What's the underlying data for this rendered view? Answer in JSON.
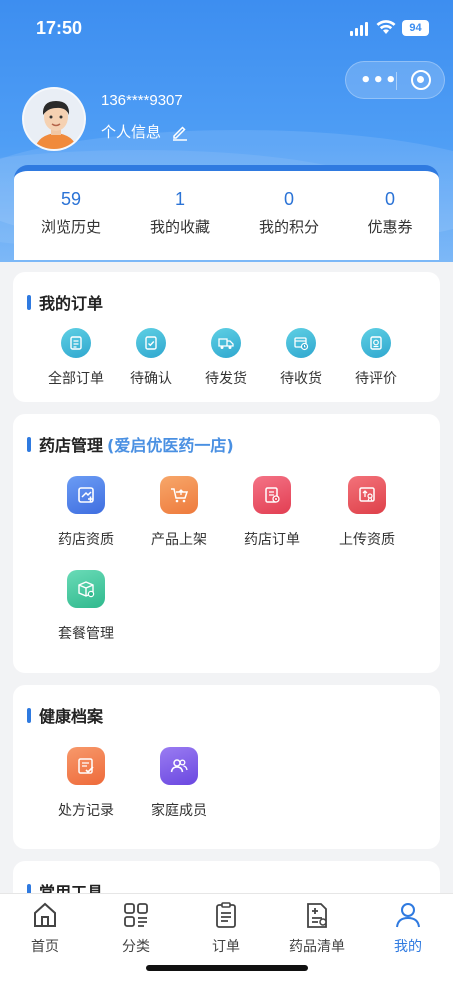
{
  "status": {
    "time": "17:50",
    "battery": "94"
  },
  "user": {
    "phone": "136****9307",
    "profile_label": "个人信息"
  },
  "stats": [
    {
      "value": "59",
      "label": "浏览历史"
    },
    {
      "value": "1",
      "label": "我的收藏"
    },
    {
      "value": "0",
      "label": "我的积分"
    },
    {
      "value": "0",
      "label": "优惠券"
    }
  ],
  "orders": {
    "title": "我的订单",
    "items": [
      {
        "label": "全部订单",
        "icon": "clipboard-icon"
      },
      {
        "label": "待确认",
        "icon": "check-document-icon"
      },
      {
        "label": "待发货",
        "icon": "truck-icon"
      },
      {
        "label": "待收货",
        "icon": "box-clock-icon"
      },
      {
        "label": "待评价",
        "icon": "review-icon"
      }
    ]
  },
  "pharmacy": {
    "title": "药店管理",
    "store_name": "(爱启优医药一店)",
    "items": [
      {
        "label": "药店资质",
        "icon": "certificate-icon",
        "color": "#4a7de8"
      },
      {
        "label": "产品上架",
        "icon": "cart-upload-icon",
        "color": "#f08a4b"
      },
      {
        "label": "药店订单",
        "icon": "order-settings-icon",
        "color": "#ec4d5f"
      },
      {
        "label": "上传资质",
        "icon": "upload-certificate-icon",
        "color": "#e8505b"
      },
      {
        "label": "套餐管理",
        "icon": "package-settings-icon",
        "color": "#3ec9a0"
      }
    ]
  },
  "health": {
    "title": "健康档案",
    "items": [
      {
        "label": "处方记录",
        "icon": "prescription-icon",
        "color": "#f0794b"
      },
      {
        "label": "家庭成员",
        "icon": "family-icon",
        "color": "#7c5ae6"
      }
    ]
  },
  "tools": {
    "title": "常用工具"
  },
  "tabbar": [
    {
      "label": "首页",
      "icon": "home-icon"
    },
    {
      "label": "分类",
      "icon": "category-icon"
    },
    {
      "label": "订单",
      "icon": "order-list-icon"
    },
    {
      "label": "药品清单",
      "icon": "drug-list-icon"
    },
    {
      "label": "我的",
      "icon": "profile-icon",
      "active": true
    }
  ],
  "colors": {
    "primary": "#2f7ae0",
    "header": "#3d8ef0"
  }
}
